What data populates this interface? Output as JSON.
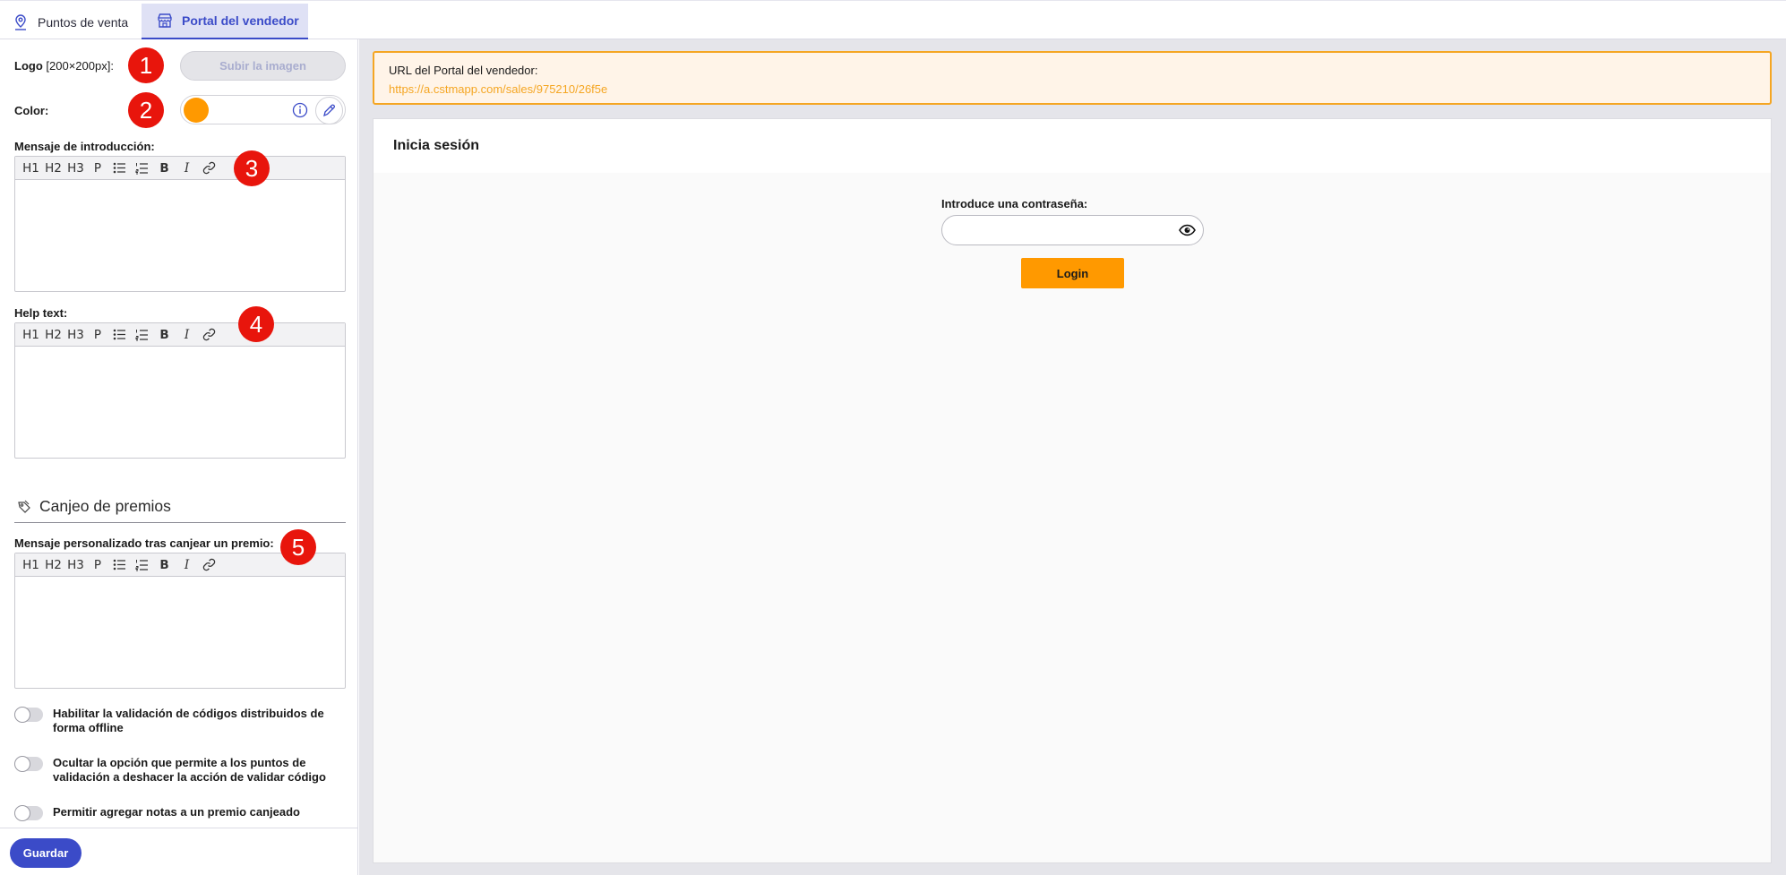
{
  "tabs": [
    {
      "label": "Puntos de venta",
      "icon": "location-pin-icon",
      "active": false
    },
    {
      "label": "Portal del vendedor",
      "icon": "storefront-icon",
      "active": true
    }
  ],
  "left": {
    "logo_label": "Logo",
    "logo_size": "[200×200px]:",
    "upload_button": "Subir la imagen",
    "color_label": "Color:",
    "color_value": "#ff9900",
    "intro_label": "Mensaje de introducción:",
    "help_label": "Help text:",
    "toolbar": {
      "h1": "H1",
      "h2": "H2",
      "h3": "H3",
      "p": "P",
      "bold": "B",
      "italic": "I"
    },
    "section_title": "Canjeo de premios",
    "redeem_label": "Mensaje personalizado tras canjear un premio:",
    "toggles": [
      {
        "label": "Habilitar la validación de códigos distribuidos de forma offline",
        "on": false
      },
      {
        "label": "Ocultar la opción que permite a los puntos de validación a deshacer la acción de validar código",
        "on": false
      },
      {
        "label": "Permitir agregar notas a un premio canjeado",
        "on": false
      }
    ],
    "save_button": "Guardar"
  },
  "badges": [
    "1",
    "2",
    "3",
    "4",
    "5"
  ],
  "right": {
    "url_label": "URL del Portal del vendedor:",
    "url": "https://a.cstmapp.com/sales/975210/26f5e",
    "preview_title": "Inicia sesión",
    "password_label": "Introduce una contraseña:",
    "login_button": "Login"
  },
  "colors": {
    "accent": "#3b4bc8",
    "brand_orange": "#ff9900",
    "badge_red": "#e8150c"
  }
}
